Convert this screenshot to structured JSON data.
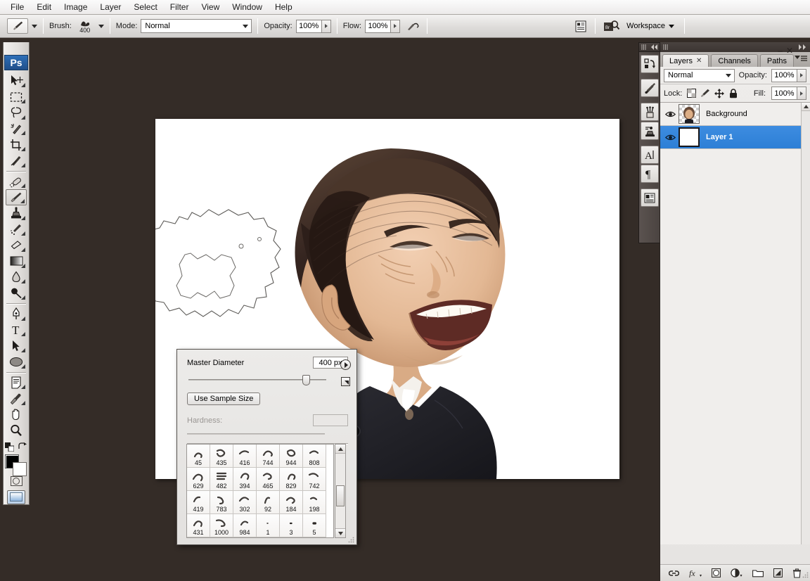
{
  "app": {
    "name": "Adobe Photoshop",
    "logo_text": "Ps"
  },
  "menubar": {
    "items": [
      {
        "label": "File"
      },
      {
        "label": "Edit"
      },
      {
        "label": "Image"
      },
      {
        "label": "Layer"
      },
      {
        "label": "Select"
      },
      {
        "label": "Filter"
      },
      {
        "label": "View"
      },
      {
        "label": "Window"
      },
      {
        "label": "Help"
      }
    ]
  },
  "options_bar": {
    "tool_preset_icon": "brush-icon",
    "brush_label": "Brush:",
    "brush_size": "400",
    "mode_label": "Mode:",
    "mode_value": "Normal",
    "opacity_label": "Opacity:",
    "opacity_value": "100%",
    "flow_label": "Flow:",
    "flow_value": "100%",
    "airbrush_icon": "airbrush-icon",
    "palettes_icon": "toggle-palettes-icon",
    "bridge_icon": "go-to-bridge-icon",
    "workspace_label": "Workspace"
  },
  "toolbar": {
    "tools": [
      {
        "name": "move-tool",
        "glyph": "➤",
        "selected": false,
        "submenu": true
      },
      {
        "name": "marquee-tool",
        "glyph": "▭",
        "selected": false,
        "submenu": true
      },
      {
        "name": "lasso-tool",
        "glyph": "◠",
        "selected": false,
        "submenu": true
      },
      {
        "name": "magic-wand-tool",
        "glyph": "✧",
        "selected": false,
        "submenu": true
      },
      {
        "name": "crop-tool",
        "glyph": "⌗",
        "selected": false,
        "submenu": true
      },
      {
        "name": "slice-tool",
        "glyph": "✂",
        "selected": false,
        "submenu": true
      },
      {
        "name": "healing-brush-tool",
        "glyph": "✒",
        "selected": false,
        "submenu": true
      },
      {
        "name": "brush-tool",
        "glyph": "🖌",
        "selected": true,
        "submenu": true
      },
      {
        "name": "clone-stamp-tool",
        "glyph": "⚘",
        "selected": false,
        "submenu": true
      },
      {
        "name": "history-brush-tool",
        "glyph": "✎",
        "selected": false,
        "submenu": true
      },
      {
        "name": "eraser-tool",
        "glyph": "▱",
        "selected": false,
        "submenu": true
      },
      {
        "name": "gradient-tool",
        "glyph": "▮",
        "selected": false,
        "submenu": true
      },
      {
        "name": "blur-tool",
        "glyph": "💧",
        "selected": false,
        "submenu": true
      },
      {
        "name": "dodge-tool",
        "glyph": "●",
        "selected": false,
        "submenu": true
      },
      {
        "name": "pen-tool",
        "glyph": "✑",
        "selected": false,
        "submenu": true
      },
      {
        "name": "type-tool",
        "glyph": "T",
        "selected": false,
        "submenu": true
      },
      {
        "name": "path-selection-tool",
        "glyph": "➤",
        "selected": false,
        "submenu": true
      },
      {
        "name": "ellipse-shape-tool",
        "glyph": "⬬",
        "selected": false,
        "submenu": true
      },
      {
        "name": "notes-tool",
        "glyph": "▤",
        "selected": false,
        "submenu": true
      },
      {
        "name": "eyedropper-tool",
        "glyph": "✐",
        "selected": false,
        "submenu": true
      },
      {
        "name": "hand-tool",
        "glyph": "✋",
        "selected": false,
        "submenu": false
      },
      {
        "name": "zoom-tool",
        "glyph": "🔍",
        "selected": false,
        "submenu": false
      }
    ],
    "foreground_color": "#000000",
    "background_color": "#ffffff",
    "quick_mask_icon": "quick-mask-icon",
    "screen_mode_icon": "screen-mode-icon"
  },
  "brush_popup": {
    "master_diameter_label": "Master Diameter",
    "master_diameter_value": "400 px",
    "use_sample_size_label": "Use Sample Size",
    "hardness_label": "Hardness:",
    "hardness_value": "",
    "menu_icon": "popup-menu-icon",
    "preset_menu_icon": "preset-manager-icon",
    "presets": [
      {
        "size": "45"
      },
      {
        "size": "435"
      },
      {
        "size": "416"
      },
      {
        "size": "744"
      },
      {
        "size": "944"
      },
      {
        "size": "808"
      },
      {
        "size": "629"
      },
      {
        "size": "482"
      },
      {
        "size": "394"
      },
      {
        "size": "465"
      },
      {
        "size": "829"
      },
      {
        "size": "742"
      },
      {
        "size": "419"
      },
      {
        "size": "783"
      },
      {
        "size": "302"
      },
      {
        "size": "92"
      },
      {
        "size": "184"
      },
      {
        "size": "198"
      },
      {
        "size": "431"
      },
      {
        "size": "1000"
      },
      {
        "size": "984"
      },
      {
        "size": "1"
      },
      {
        "size": "3"
      },
      {
        "size": "5"
      }
    ]
  },
  "icon_dock": {
    "buttons": [
      {
        "name": "history-panel-icon",
        "glyph": "↺"
      },
      {
        "name": "tool-presets-panel-icon",
        "glyph": "✕"
      },
      {
        "name": "brushes-panel-icon",
        "glyph": "🖌"
      },
      {
        "name": "clone-source-panel-icon",
        "glyph": "⚙"
      },
      {
        "name": "character-panel-icon",
        "glyph": "A"
      },
      {
        "name": "paragraph-panel-icon",
        "glyph": "¶"
      },
      {
        "name": "info-panel-icon",
        "glyph": "▤"
      }
    ]
  },
  "layers_panel": {
    "tabs": [
      {
        "label": "Layers",
        "active": true,
        "closable": true
      },
      {
        "label": "Channels",
        "active": false,
        "closable": false
      },
      {
        "label": "Paths",
        "active": false,
        "closable": false
      }
    ],
    "minimize_glyph": "–",
    "close_glyph": "✕",
    "blend_mode_label": "",
    "blend_mode_value": "Normal",
    "opacity_label": "Opacity:",
    "opacity_value": "100%",
    "lock_label": "Lock:",
    "lock_icons": [
      {
        "name": "lock-transparent-pixels-icon",
        "glyph": "▧"
      },
      {
        "name": "lock-image-pixels-icon",
        "glyph": "🖌"
      },
      {
        "name": "lock-position-icon",
        "glyph": "✛"
      },
      {
        "name": "lock-all-icon",
        "glyph": "🔒"
      }
    ],
    "fill_label": "Fill:",
    "fill_value": "100%",
    "layers": [
      {
        "name": "Background",
        "visible": true,
        "selected": false,
        "thumb": "portrait"
      },
      {
        "name": "Layer 1",
        "visible": true,
        "selected": true,
        "thumb": "white"
      }
    ],
    "selected_color": "#2d7fd6",
    "bottom_buttons": [
      {
        "name": "link-layers-icon",
        "glyph": "🔗"
      },
      {
        "name": "layer-style-icon",
        "glyph": "fx"
      },
      {
        "name": "layer-mask-icon",
        "glyph": "◐"
      },
      {
        "name": "adjustment-layer-icon",
        "glyph": "◑"
      },
      {
        "name": "new-group-icon",
        "glyph": "🗀"
      },
      {
        "name": "new-layer-icon",
        "glyph": "❐"
      },
      {
        "name": "delete-layer-icon",
        "glyph": "🗑"
      }
    ]
  },
  "document": {
    "background_color": "#ffffff",
    "canvas_color": "#342c27",
    "artwork": "caricature-portrait-of-smiling-man"
  }
}
